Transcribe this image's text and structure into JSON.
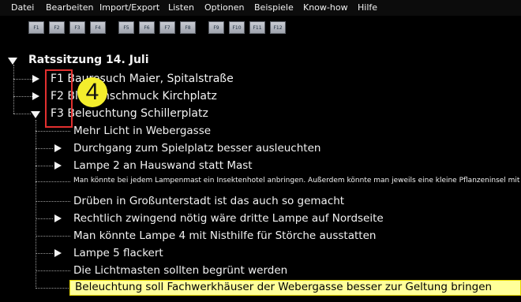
{
  "menu": [
    "Datei",
    "Bearbeiten",
    "Import/Export",
    "Listen",
    "Optionen",
    "Beispiele",
    "Know-how",
    "Hilfe"
  ],
  "fkeys": [
    "F1",
    "F2",
    "F3",
    "F4",
    "F5",
    "F6",
    "F7",
    "F8",
    "F9",
    "F10",
    "F11",
    "F12"
  ],
  "tree": {
    "root": "Ratssitzung 14. Juli",
    "items": [
      {
        "label": "F1 Bauresuch Maier, Spitalstraße"
      },
      {
        "label": "F2 Blumenschmuck Kirchplatz"
      },
      {
        "label": "F3 Beleuchtung Schillerplatz"
      }
    ],
    "children": [
      "Mehr Licht in Webergasse",
      "Durchgang zum Spielplatz besser ausleuchten",
      "Lampe 2 an Hauswand statt Mast",
      "Man könnte bei jedem Lampenmast ein Insektenhotel anbringen. Außerdem könnte man jeweils eine kleine Pflanzeninsel mit",
      "Drüben in Großunterstadt ist das auch so gemacht",
      "Rechtlich zwingend nötig wäre dritte Lampe auf Nordseite",
      "Man könnte Lampe 4 mit Nisthilfe für Störche ausstatten",
      "Lampe 5 flackert",
      "Die Lichtmasten sollten begrünt werden",
      "Beleuchtung soll Fachwerkhäuser der Webergasse besser zur Geltung bringen"
    ]
  },
  "callout_number": "4",
  "colors": {
    "highlight": "#ffff9a",
    "callout": "#f4ee2c",
    "annotation_box": "#e2302f"
  }
}
